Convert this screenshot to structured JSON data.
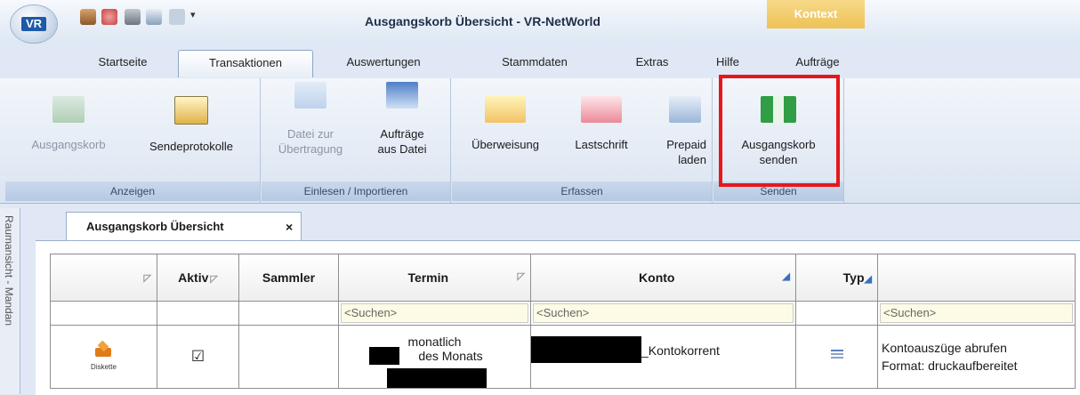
{
  "window": {
    "title": "Ausgangskorb Übersicht - VR-NetWorld",
    "context_tab": "Kontext",
    "logo_text": "VR"
  },
  "tabs": [
    "Startseite",
    "Transaktionen",
    "Auswertungen",
    "Stammdaten",
    "Extras",
    "Hilfe",
    "Aufträge"
  ],
  "ribbon": {
    "anzeigen": {
      "label": "Anzeigen",
      "ausgangskorb": "Ausgangskorb",
      "sendeprotokolle": "Sendeprotokolle"
    },
    "einlesen": {
      "label": "Einlesen / Importieren",
      "datei_line1": "Datei zur",
      "datei_line2": "Übertragung",
      "auftraege_line1": "Aufträge",
      "auftraege_line2": "aus Datei"
    },
    "erfassen": {
      "label": "Erfassen",
      "ueberweisung": "Überweisung",
      "lastschrift": "Lastschrift",
      "prepaid_line1": "Prepaid",
      "prepaid_line2": "laden"
    },
    "senden": {
      "label": "Senden",
      "line1": "Ausgangskorb",
      "line2": "senden"
    }
  },
  "sidebar": {
    "label": "Raumansicht - Mandan"
  },
  "document_tab": {
    "label": "Ausgangskorb Übersicht",
    "close": "×"
  },
  "grid": {
    "headers": [
      "",
      "Aktiv",
      "Sammler",
      "Termin",
      "Konto",
      "Typ",
      ""
    ],
    "search_placeholder": "<Suchen>",
    "row": {
      "icon_label": "Diskette",
      "aktiv": "☑",
      "termin_line1": "monatlich",
      "termin_line2": "des Monats",
      "konto": "_Kontokorrent",
      "beschreibung_line1": "Kontoauszüge abrufen",
      "beschreibung_line2": "Format: druckaufbereitet"
    }
  },
  "colors": {
    "highlight": "#e8161c",
    "kontext": "#eec255",
    "search_bg": "#fdfbe5"
  }
}
